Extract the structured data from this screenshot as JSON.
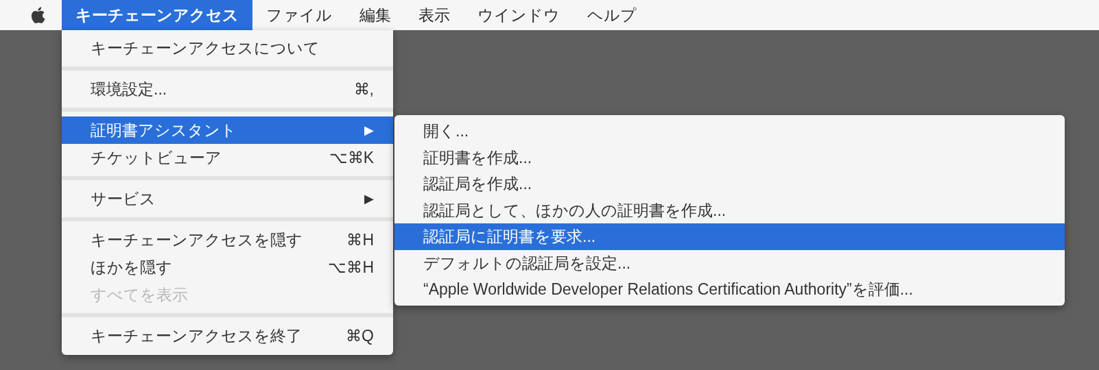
{
  "menu_bar": {
    "items": [
      {
        "label": "キーチェーンアクセス",
        "selected": true
      },
      {
        "label": "ファイル",
        "selected": false
      },
      {
        "label": "編集",
        "selected": false
      },
      {
        "label": "表示",
        "selected": false
      },
      {
        "label": "ウインドウ",
        "selected": false
      },
      {
        "label": "ヘルプ",
        "selected": false
      }
    ]
  },
  "menu": {
    "items": [
      {
        "kind": "item",
        "label": "キーチェーンアクセスについて",
        "selected": false,
        "disabled": false
      },
      {
        "kind": "separator"
      },
      {
        "kind": "item",
        "label": "環境設定...",
        "shortcut": "⌘,",
        "selected": false,
        "disabled": false
      },
      {
        "kind": "separator"
      },
      {
        "kind": "item",
        "label": "証明書アシスタント",
        "arrow": "▶",
        "selected": true,
        "disabled": false
      },
      {
        "kind": "item",
        "label": "チケットビューア",
        "shortcut": "⌥⌘K",
        "selected": false,
        "disabled": false
      },
      {
        "kind": "separator"
      },
      {
        "kind": "item",
        "label": "サービス",
        "arrow": "▶",
        "selected": false,
        "disabled": false
      },
      {
        "kind": "separator"
      },
      {
        "kind": "item",
        "label": "キーチェーンアクセスを隠す",
        "shortcut": "⌘H",
        "selected": false,
        "disabled": false
      },
      {
        "kind": "item",
        "label": "ほかを隠す",
        "shortcut": "⌥⌘H",
        "selected": false,
        "disabled": false
      },
      {
        "kind": "item",
        "label": "すべてを表示",
        "selected": false,
        "disabled": true
      },
      {
        "kind": "separator"
      },
      {
        "kind": "item",
        "label": "キーチェーンアクセスを終了",
        "shortcut": "⌘Q",
        "selected": false,
        "disabled": false
      }
    ]
  },
  "submenu": {
    "items": [
      {
        "label": "開く...",
        "selected": false
      },
      {
        "label": "証明書を作成...",
        "selected": false
      },
      {
        "label": "認証局を作成...",
        "selected": false
      },
      {
        "label": "認証局として、ほかの人の証明書を作成...",
        "selected": false
      },
      {
        "label": "認証局に証明書を要求...",
        "selected": true
      },
      {
        "label": "デフォルトの認証局を設定...",
        "selected": false
      },
      {
        "label": "“Apple Worldwide Developer Relations Certification Authority”を評価...",
        "selected": false
      }
    ]
  }
}
